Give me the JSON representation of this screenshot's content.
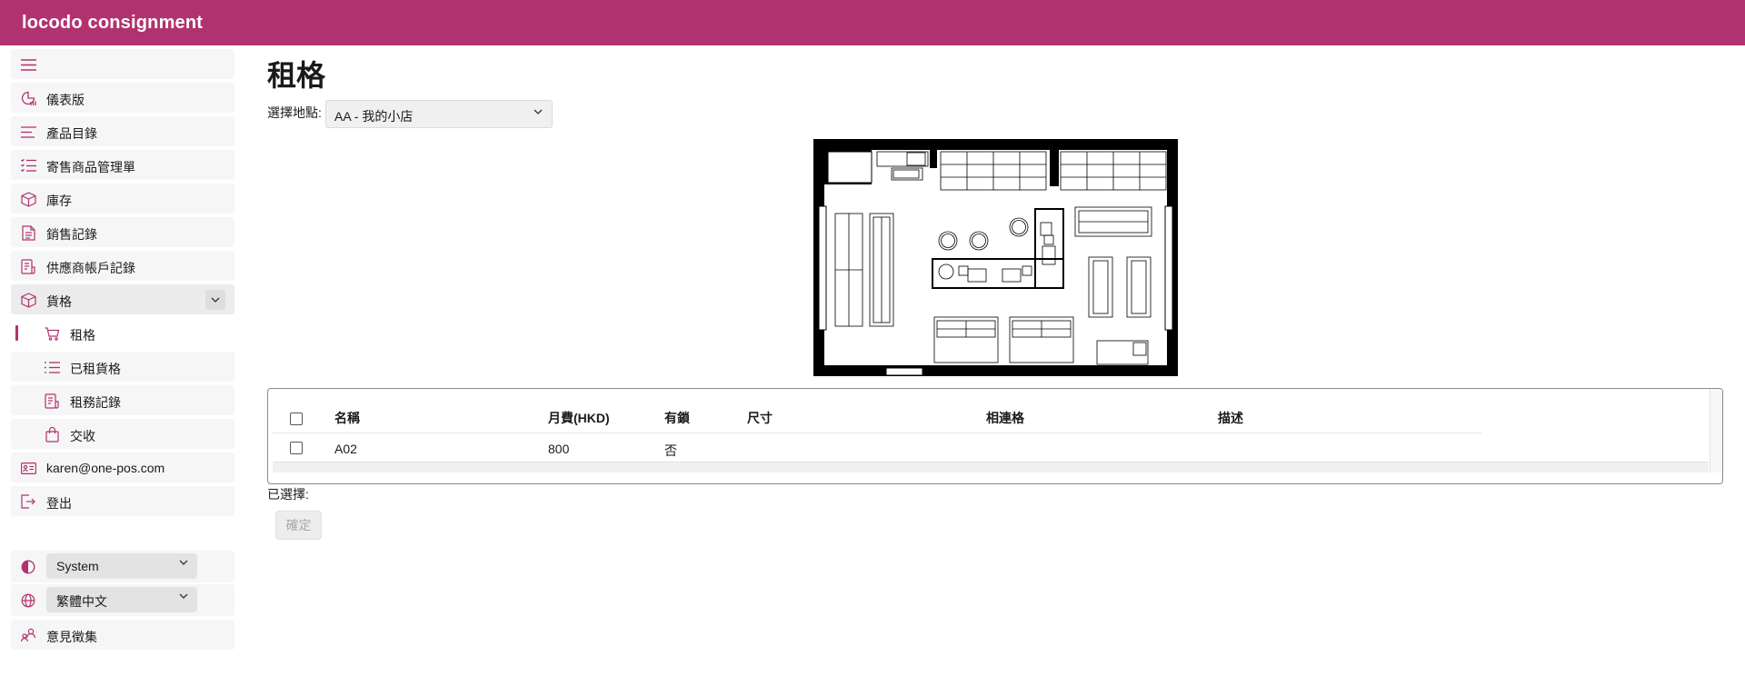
{
  "app": {
    "brand": "locodo consignment"
  },
  "colors": {
    "accent": "#b0336f",
    "topbar": "#b0336f"
  },
  "sidebar": {
    "menu_icon": "hamburger-icon",
    "items": [
      {
        "label": "儀表版",
        "icon": "dashboard-icon"
      },
      {
        "label": "產品目錄",
        "icon": "list-lines-icon"
      },
      {
        "label": "寄售商品管理單",
        "icon": "checklist-icon"
      },
      {
        "label": "庫存",
        "icon": "box-icon"
      },
      {
        "label": "銷售記錄",
        "icon": "document-icon"
      },
      {
        "label": "供應商帳戶記錄",
        "icon": "ledger-icon"
      },
      {
        "label": "貨格",
        "icon": "box-icon",
        "expanded": true
      },
      {
        "label": "租格",
        "icon": "cart-icon",
        "active": true
      },
      {
        "label": "已租貨格",
        "icon": "list-icon"
      },
      {
        "label": "租務記錄",
        "icon": "ledger-icon"
      },
      {
        "label": "交收",
        "icon": "shopping-bag-icon"
      },
      {
        "label": "karen@one-pos.com",
        "icon": "id-card-icon"
      },
      {
        "label": "登出",
        "icon": "logout-icon"
      }
    ],
    "theme_select": {
      "value": "System",
      "icon": "contrast-icon"
    },
    "language_select": {
      "value": "繁體中文",
      "icon": "globe-icon"
    },
    "feedback": {
      "label": "意見徵集",
      "icon": "people-icon"
    }
  },
  "main": {
    "title": "租格",
    "location_label": "選擇地點:",
    "location_value": "AA - 我的小店",
    "table": {
      "headers": [
        "名稱",
        "月費(HKD)",
        "有鎖",
        "尺寸",
        "相連格",
        "描述"
      ],
      "rows": [
        {
          "name": "A02",
          "fee": "800",
          "locked": "否",
          "size": "",
          "linked": "",
          "description": ""
        }
      ]
    },
    "selected_label": "已選擇:",
    "confirm_label": "確定"
  }
}
